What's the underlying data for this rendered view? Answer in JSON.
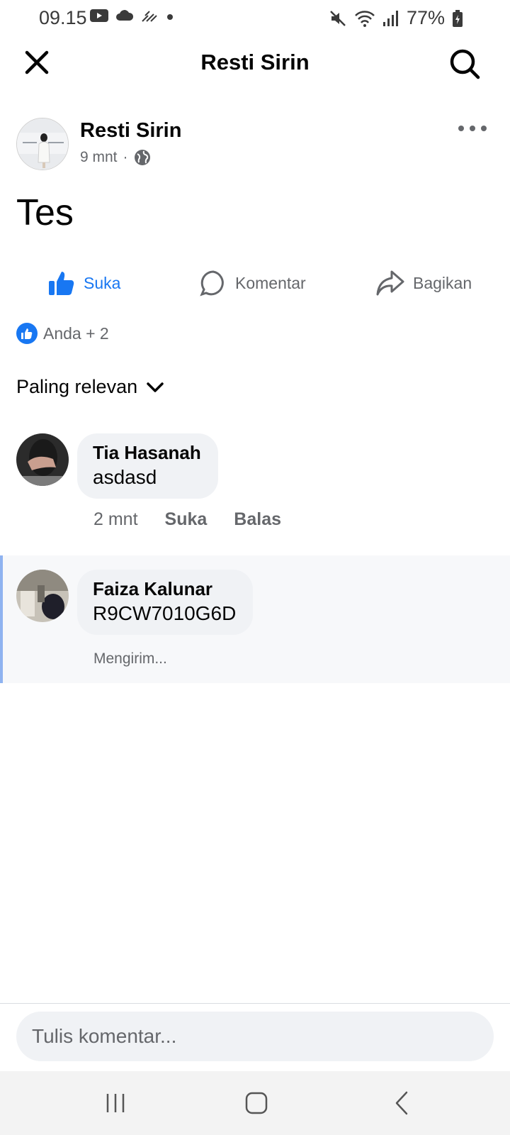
{
  "status_bar": {
    "time": "09.15",
    "battery": "77%",
    "icons_left": [
      "youtube-icon",
      "cloud-icon",
      "signal-lines-icon",
      "dot-icon"
    ],
    "icons_right": [
      "mute-icon",
      "wifi-icon",
      "cellular-icon",
      "battery-icon"
    ]
  },
  "header": {
    "title": "Resti Sirin"
  },
  "post": {
    "author": "Resti Sirin",
    "time": "9 mnt",
    "separator": "·",
    "text": "Tes"
  },
  "actions": {
    "like": "Suka",
    "comment": "Komentar",
    "share": "Bagikan"
  },
  "reactions": {
    "summary": "Anda + 2"
  },
  "sort": {
    "label": "Paling relevan"
  },
  "comments": [
    {
      "name": "Tia Hasanah",
      "text": "asdasd",
      "time": "2 mnt",
      "like": "Suka",
      "reply": "Balas"
    },
    {
      "name": "Faiza Kalunar",
      "text": "R9CW7010G6D",
      "status": "Mengirim..."
    }
  ],
  "input": {
    "placeholder": "Tulis komentar..."
  },
  "colors": {
    "accent": "#1877f2",
    "secondary_text": "#65676b",
    "bubble": "#f0f2f5"
  }
}
